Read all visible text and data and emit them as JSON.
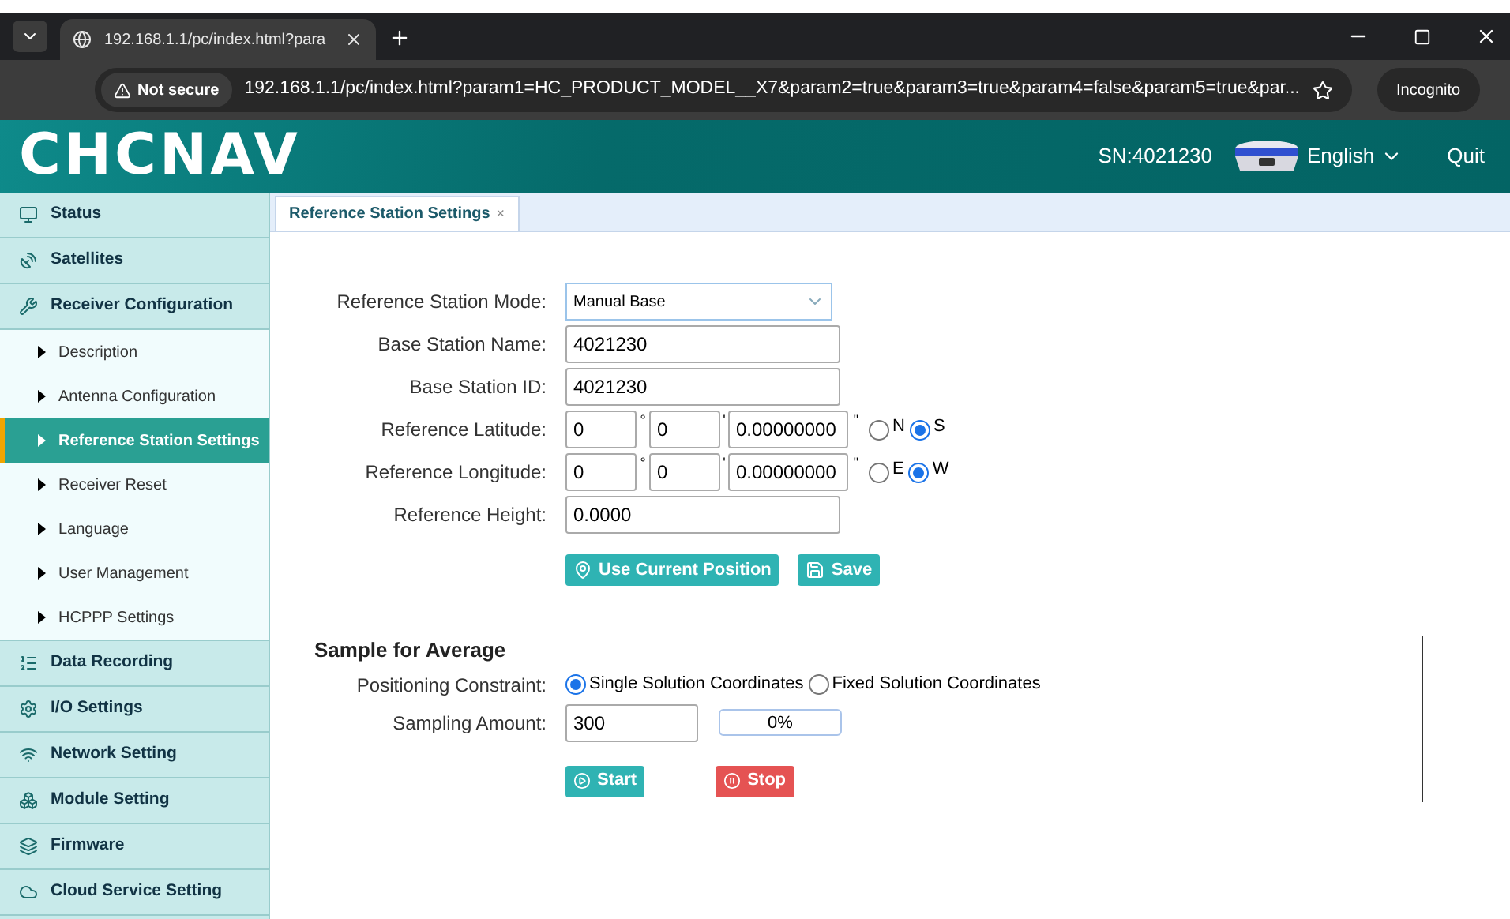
{
  "browser": {
    "tab_title": "192.168.1.1/pc/index.html?para",
    "security": "Not secure",
    "url": "192.168.1.1/pc/index.html?param1=HC_PRODUCT_MODEL__X7&param2=true&param3=true&param4=false&param5=true&par...",
    "profile": "Incognito"
  },
  "header": {
    "logo": "CHCNAV",
    "serial": "SN:4021230",
    "language": "English",
    "quit": "Quit"
  },
  "sidebar": [
    {
      "label": "Status"
    },
    {
      "label": "Satellites"
    },
    {
      "label": "Receiver Configuration",
      "children": [
        {
          "label": "Description",
          "selected": false
        },
        {
          "label": "Antenna Configuration",
          "selected": false
        },
        {
          "label": "Reference Station Settings",
          "selected": true
        },
        {
          "label": "Receiver Reset",
          "selected": false
        },
        {
          "label": "Language",
          "selected": false
        },
        {
          "label": "User Management",
          "selected": false
        },
        {
          "label": "HCPPP Settings",
          "selected": false
        }
      ]
    },
    {
      "label": "Data Recording"
    },
    {
      "label": "I/O Settings"
    },
    {
      "label": "Network Setting"
    },
    {
      "label": "Module Setting"
    },
    {
      "label": "Firmware"
    },
    {
      "label": "Cloud Service Setting"
    }
  ],
  "tab": {
    "label": "Reference Station Settings",
    "close": "×"
  },
  "form": {
    "mode": {
      "label": "Reference Station Mode:",
      "value": "Manual Base"
    },
    "name": {
      "label": "Base Station Name:",
      "value": "4021230"
    },
    "id": {
      "label": "Base Station ID:",
      "value": "4021230"
    },
    "coords": [
      {
        "label": "Reference Latitude:",
        "deg": "0",
        "min": "0",
        "sec": "0.00000000",
        "marks": [
          "°",
          "'",
          "\""
        ],
        "options": [
          {
            "label": "N",
            "selected": false
          },
          {
            "label": "S",
            "selected": true
          }
        ]
      },
      {
        "label": "Reference Longitude:",
        "deg": "0",
        "min": "0",
        "sec": "0.00000000",
        "marks": [
          "°",
          "'",
          "\""
        ],
        "options": [
          {
            "label": "E",
            "selected": false
          },
          {
            "label": "W",
            "selected": true
          }
        ]
      }
    ],
    "height": {
      "label": "Reference Height:",
      "value": "0.0000"
    },
    "buttons": [
      "Use Current Position",
      "Save"
    ]
  },
  "average": {
    "title": "Sample for Average",
    "constraint_label": "Positioning Constraint:",
    "constraints": [
      {
        "label": "Single Solution Coordinates",
        "selected": true
      },
      {
        "label": "Fixed Solution Coordinates",
        "selected": false
      }
    ],
    "amount_label": "Sampling Amount:",
    "amount": "300",
    "progress": {
      "level": 0,
      "reading": "0%"
    },
    "start": "Start",
    "stop": "Stop"
  }
}
